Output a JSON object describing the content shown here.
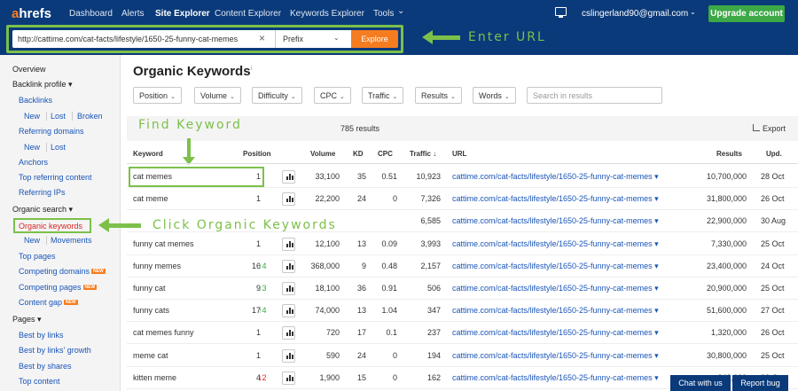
{
  "nav": {
    "logo_a": "a",
    "logo_rest": "hrefs",
    "items": [
      "Dashboard",
      "Alerts",
      "Site Explorer",
      "Content Explorer",
      "Keywords Explorer",
      "Tools"
    ],
    "tools_chevron": "⌄",
    "email": "cslingerland90@gmail.com",
    "upgrade": "Upgrade account"
  },
  "search": {
    "url": "http://cattime.com/cat-facts/lifestyle/1650-25-funny-cat-memes",
    "clear": "×",
    "mode": "Prefix",
    "explore": "Explore"
  },
  "annotations": {
    "enter_url": "Enter URL",
    "find_keyword": "Find Keyword",
    "click_organic": "Click Organic Keywords"
  },
  "sidebar": {
    "overview": "Overview",
    "backlink_profile": "Backlink profile ▾",
    "backlinks": "Backlinks",
    "bl_new": "New",
    "bl_lost": "Lost",
    "bl_broken": "Broken",
    "referring_domains": "Referring domains",
    "rd_new": "New",
    "rd_lost": "Lost",
    "anchors": "Anchors",
    "top_referring_content": "Top referring content",
    "referring_ips": "Referring IPs",
    "organic_search": "Organic search ▾",
    "organic_keywords": "Organic keywords",
    "ok_new": "New",
    "ok_movements": "Movements",
    "top_pages": "Top pages",
    "competing_domains": "Competing domains",
    "competing_pages": "Competing pages",
    "content_gap": "Content gap",
    "new_badge": "NEW",
    "pages": "Pages ▾",
    "best_by_links": "Best by links",
    "best_by_links_growth": "Best by links' growth",
    "best_by_shares": "Best by shares",
    "top_content": "Top content"
  },
  "main": {
    "title": "Organic Keywords",
    "info": "i",
    "filters": [
      "Position",
      "Volume",
      "Difficulty",
      "CPC",
      "Traffic",
      "Results",
      "Words"
    ],
    "search_placeholder": "Search in results",
    "results": "785 results",
    "export": "Export"
  },
  "table": {
    "headers": {
      "keyword": "Keyword",
      "position": "Position",
      "volume": "Volume",
      "kd": "KD",
      "cpc": "CPC",
      "traffic": "Traffic ↓",
      "url": "URL",
      "results": "Results",
      "upd": "Upd."
    },
    "rows": [
      {
        "keyword": "cat memes",
        "position": "1",
        "change": "",
        "dir": "",
        "volume": "33,100",
        "kd": "35",
        "cpc": "0.51",
        "traffic": "10,923",
        "url": "cattime.com/cat-facts/lifestyle/1650-25-funny-cat-memes ▾",
        "results": "10,700,000",
        "upd": "28 Oct"
      },
      {
        "keyword": "cat meme",
        "position": "1",
        "change": "",
        "dir": "",
        "volume": "22,200",
        "kd": "24",
        "cpc": "0",
        "traffic": "7,326",
        "url": "cattime.com/cat-facts/lifestyle/1650-25-funny-cat-memes ▾",
        "results": "31,800,000",
        "upd": "26 Oct"
      },
      {
        "keyword": "",
        "position": "",
        "change": "",
        "dir": "",
        "volume": "",
        "kd": "",
        "cpc": "",
        "traffic": "6,585",
        "url": "cattime.com/cat-facts/lifestyle/1650-25-funny-cat-memes ▾",
        "results": "22,900,000",
        "upd": "30 Aug"
      },
      {
        "keyword": "funny cat memes",
        "position": "1",
        "change": "",
        "dir": "",
        "volume": "12,100",
        "kd": "13",
        "cpc": "0.09",
        "traffic": "3,993",
        "url": "cattime.com/cat-facts/lifestyle/1650-25-funny-cat-memes ▾",
        "results": "7,330,000",
        "upd": "25 Oct"
      },
      {
        "keyword": "funny memes",
        "position": "16",
        "change": "↑4",
        "dir": "up",
        "volume": "368,000",
        "kd": "9",
        "cpc": "0.48",
        "traffic": "2,157",
        "url": "cattime.com/cat-facts/lifestyle/1650-25-funny-cat-memes ▾",
        "results": "23,400,000",
        "upd": "24 Oct"
      },
      {
        "keyword": "funny cat",
        "position": "9",
        "change": "↑3",
        "dir": "up",
        "volume": "18,100",
        "kd": "36",
        "cpc": "0.91",
        "traffic": "506",
        "url": "cattime.com/cat-facts/lifestyle/1650-25-funny-cat-memes ▾",
        "results": "20,900,000",
        "upd": "25 Oct"
      },
      {
        "keyword": "funny cats",
        "position": "17",
        "change": "↑4",
        "dir": "up",
        "volume": "74,000",
        "kd": "13",
        "cpc": "1.04",
        "traffic": "347",
        "url": "cattime.com/cat-facts/lifestyle/1650-25-funny-cat-memes ▾",
        "results": "51,600,000",
        "upd": "27 Oct"
      },
      {
        "keyword": "cat memes funny",
        "position": "1",
        "change": "",
        "dir": "",
        "volume": "720",
        "kd": "17",
        "cpc": "0.1",
        "traffic": "237",
        "url": "cattime.com/cat-facts/lifestyle/1650-25-funny-cat-memes ▾",
        "results": "1,320,000",
        "upd": "26 Oct"
      },
      {
        "keyword": "meme cat",
        "position": "1",
        "change": "",
        "dir": "",
        "volume": "590",
        "kd": "24",
        "cpc": "0",
        "traffic": "194",
        "url": "cattime.com/cat-facts/lifestyle/1650-25-funny-cat-memes ▾",
        "results": "30,800,000",
        "upd": "25 Oct"
      },
      {
        "keyword": "kitten meme",
        "position": "4",
        "change": "↓2",
        "dir": "down",
        "volume": "1,900",
        "kd": "15",
        "cpc": "0",
        "traffic": "162",
        "url": "cattime.com/cat-facts/lifestyle/1650-25-funny-cat-memes ▾",
        "results": "848,000",
        "upd": "22 Oct"
      }
    ]
  },
  "footer": {
    "chat": "Chat with us",
    "report": "Report bug"
  }
}
